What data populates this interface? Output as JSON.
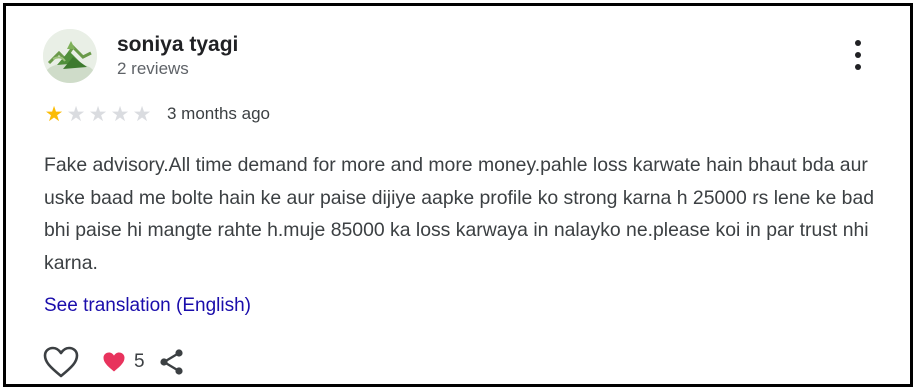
{
  "reviewer": {
    "name": "soniya tyagi",
    "reviews_count": "2 reviews"
  },
  "rating": {
    "value": 1,
    "max": 5,
    "filled_color": "#fbbc04",
    "empty_color": "#dadce0",
    "date": "3 months ago"
  },
  "review": {
    "text": "Fake advisory.All time demand for more and more money.pahle loss karwate hain bhaut bda aur uske baad me bolte hain ke aur paise dijiye aapke profile ko strong karna h 25000 rs lene ke bad bhi paise hi mangte rahte h.muje 85000 ka loss karwaya in nalayko ne.please koi in par trust nhi karna."
  },
  "translation_link": "See translation (English)",
  "actions": {
    "reaction_count": "5",
    "icons": [
      "heart-outline-icon",
      "heart-reaction-icon",
      "share-icon"
    ],
    "reaction_color": "#e8335d"
  },
  "menu_icon": "more-vert-icon"
}
